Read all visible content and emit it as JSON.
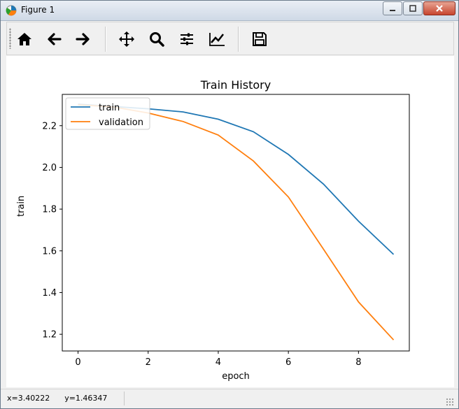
{
  "window": {
    "title": "Figure 1"
  },
  "toolbar": {
    "buttons": [
      {
        "name": "home",
        "icon": "home-icon"
      },
      {
        "name": "back",
        "icon": "arrow-left-icon"
      },
      {
        "name": "forward",
        "icon": "arrow-right-icon"
      },
      {
        "name": "pan",
        "icon": "move-icon"
      },
      {
        "name": "zoom",
        "icon": "magnifier-icon"
      },
      {
        "name": "subplots",
        "icon": "sliders-icon"
      },
      {
        "name": "edit-axis",
        "icon": "line-chart-icon"
      },
      {
        "name": "save",
        "icon": "floppy-disk-icon"
      }
    ]
  },
  "status": {
    "x": "x=3.40222",
    "y": "y=1.46347"
  },
  "colors": {
    "train": "#1f77b4",
    "validation": "#ff7f0e"
  },
  "chart_data": {
    "type": "line",
    "title": "Train History",
    "xlabel": "epoch",
    "ylabel": "train",
    "x": [
      0,
      1,
      2,
      3,
      4,
      5,
      6,
      7,
      8,
      9
    ],
    "series": [
      {
        "name": "train",
        "values": [
          2.303,
          2.292,
          2.281,
          2.266,
          2.231,
          2.171,
          2.062,
          1.92,
          1.742,
          1.583
        ]
      },
      {
        "name": "validation",
        "values": [
          2.3,
          2.29,
          2.261,
          2.22,
          2.155,
          2.031,
          1.858,
          1.608,
          1.355,
          1.173
        ]
      }
    ],
    "xlim": [
      -0.45,
      9.45
    ],
    "ylim": [
      1.12,
      2.35
    ],
    "xticks": [
      0,
      2,
      4,
      6,
      8
    ],
    "yticks": [
      1.2,
      1.4,
      1.6,
      1.8,
      2.0,
      2.2
    ],
    "legend": "upper left",
    "grid": false
  }
}
